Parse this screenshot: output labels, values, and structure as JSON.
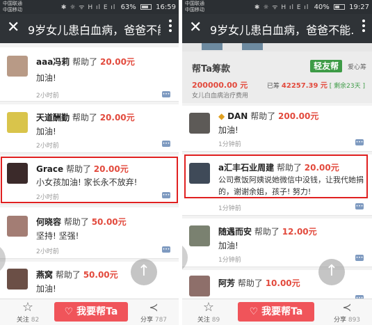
{
  "left": {
    "status": {
      "carrier1": "中国联通",
      "carrier2": "中国移动",
      "icons": "✱ ☼ ᯤ H ıl E ıl",
      "battery_pct": "63%",
      "time": "16:59",
      "battery_level": 0.63
    },
    "title": "9岁女儿患白血病，爸爸不能…",
    "posts": [
      {
        "name": "aaa冯莉",
        "helped": "帮助了",
        "amount": "20.00元",
        "message": "加油!",
        "time": "2小时前"
      },
      {
        "name": "天道酬勤",
        "helped": "帮助了",
        "amount": "20.00元",
        "message": "加油!",
        "time": "2小时前"
      },
      {
        "name": "Grace",
        "helped": "帮助了",
        "amount": "20.00元",
        "message": "小女孩加油! 家长永不放弃!",
        "time": "2小时前"
      },
      {
        "name": "何晓容",
        "helped": "帮助了",
        "amount": "50.00元",
        "message": "坚持! 坚强!",
        "time": "2小时前"
      },
      {
        "name": "燕窝",
        "helped": "帮助了",
        "amount": "50.00元",
        "message": "加油!",
        "time": ""
      }
    ],
    "bottom": {
      "follow": "关注",
      "follow_count": "82",
      "help_button": "我要帮Ta",
      "share": "分享",
      "share_count": "787"
    }
  },
  "right": {
    "status": {
      "carrier1": "中国联通",
      "carrier2": "中国移动",
      "icons": "✱ ☼ ᯤ H ıl E ıl",
      "battery_pct": "40%",
      "time": "19:27",
      "battery_level": 0.4
    },
    "title": "9岁女儿患白血病，爸爸不能…",
    "fund": {
      "title": "帮Ta筹款",
      "brand": "轻友帮",
      "brand_sub": "爱心筹",
      "target": "200000.00 元",
      "raised_prefix": "已筹",
      "raised_value": "42257.39 元",
      "days_left": "[ 剩余23天 ]",
      "purpose": "女儿白血病治疗费用"
    },
    "posts": [
      {
        "name": "DAN",
        "helped": "帮助了",
        "amount": "200.00元",
        "message": "加油!",
        "time": "1分钟前"
      },
      {
        "name": "a汇丰石业周建",
        "helped": "帮助了",
        "amount": "20.00元",
        "message": "公司煮饭阿姨说她微信中没钱，让我代她捐的，谢谢余姐，孩子! 努力!",
        "time": "1分钟前"
      },
      {
        "name": "随遇而安",
        "helped": "帮助了",
        "amount": "12.00元",
        "message": "加油!",
        "time": "1分钟前"
      },
      {
        "name": "阿芳",
        "helped": "帮助了",
        "amount": "10.00元",
        "message": "",
        "time": ""
      }
    ],
    "bottom": {
      "follow": "关注",
      "follow_count": "89",
      "help_button": "我要帮Ta",
      "share": "分享",
      "share_count": "893"
    }
  },
  "icons": {
    "close": "close-icon",
    "more": "more-icon",
    "star": "star-icon",
    "heart": "heart-icon",
    "share": "share-icon",
    "top": "back-to-top-icon",
    "comment": "comment-icon"
  },
  "colors": {
    "accent_red": "#f0545a",
    "amount_red": "#e24a3d",
    "highlight_border": "#e02020",
    "brand_green": "#3d9b46"
  }
}
